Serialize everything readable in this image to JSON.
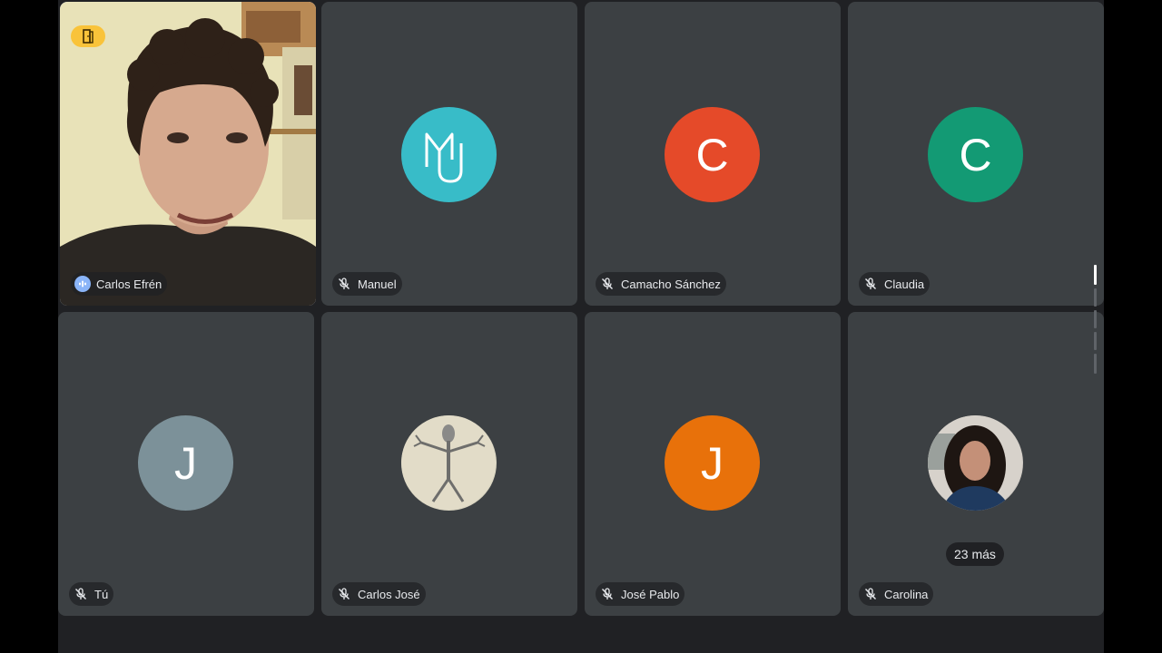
{
  "participants": [
    {
      "name": "Carlos Efrén",
      "mic": "speaking",
      "video": true
    },
    {
      "name": "Manuel",
      "mic": "muted",
      "avatar": "MJ-logo",
      "color": "#38bcc8"
    },
    {
      "name": "Camacho Sánchez",
      "mic": "muted",
      "initial": "C",
      "color": "#e54a29"
    },
    {
      "name": "Claudia",
      "mic": "muted",
      "initial": "C",
      "color": "#139a74"
    },
    {
      "name": "Tú",
      "mic": "muted",
      "initial": "J",
      "color": "#7c9199"
    },
    {
      "name": "Carlos José",
      "mic": "muted",
      "avatar": "photo"
    },
    {
      "name": "José Pablo",
      "mic": "muted",
      "initial": "J",
      "color": "#e8710a"
    },
    {
      "name": "Carolina",
      "mic": "muted",
      "avatar": "photo"
    }
  ],
  "more_label": "23 más",
  "colors": {
    "tile": "#3c4043",
    "background": "#202124",
    "active_outline": "#4a6bd8",
    "badge": "#f9c33a"
  }
}
